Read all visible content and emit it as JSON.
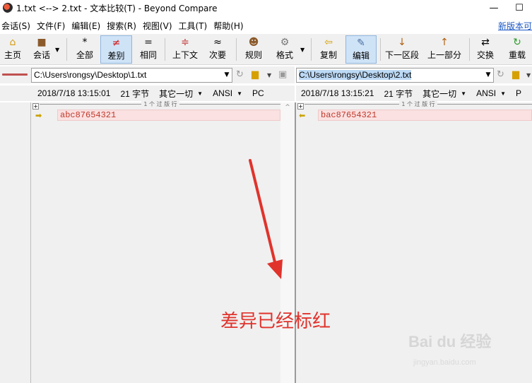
{
  "window": {
    "title": "1.txt <--> 2.txt - 文本比较(T) - Beyond Compare",
    "minimize": "—",
    "maximize": "☐"
  },
  "menu": {
    "items": [
      "会话(S)",
      "文件(F)",
      "编辑(E)",
      "搜索(R)",
      "视图(V)",
      "工具(T)",
      "帮助(H)"
    ],
    "right_link": "新版本可"
  },
  "toolbar": {
    "home": "主页",
    "session": "会话",
    "all": "全部",
    "diffs": "差别",
    "same": "相同",
    "context": "上下文",
    "minor": "次要",
    "rules": "规则",
    "format": "格式",
    "copy": "复制",
    "edit": "编辑",
    "next_section": "下一区段",
    "prev_section": "上一部分",
    "swap": "交换",
    "reload": "重载"
  },
  "left": {
    "path": "C:\\Users\\rongsy\\Desktop\\1.txt",
    "date": "2018/7/18 13:15:01",
    "size": "21 字节",
    "other": "其它一切",
    "encoding": "ANSI",
    "line_ending": "PC",
    "section_label": "1 个 过 版 行",
    "line_text": "abc87654321"
  },
  "right": {
    "path": "C:\\Users\\rongsy\\Desktop\\2.txt",
    "date": "2018/7/18 13:15:21",
    "size": "21 字节",
    "other": "其它一切",
    "encoding": "ANSI",
    "line_ending": "P",
    "section_label": "1 个 过 版 行",
    "line_text": "bac87654321"
  },
  "annotation": {
    "text": "差异已经标红",
    "color": "#e0332c"
  },
  "watermark": {
    "main": "Bai du 经验",
    "sub": "jingyan.baidu.com"
  },
  "icons": {
    "left_arrow": "yellow-right-arrow-icon",
    "right_arrow": "yellow-left-arrow-icon"
  }
}
